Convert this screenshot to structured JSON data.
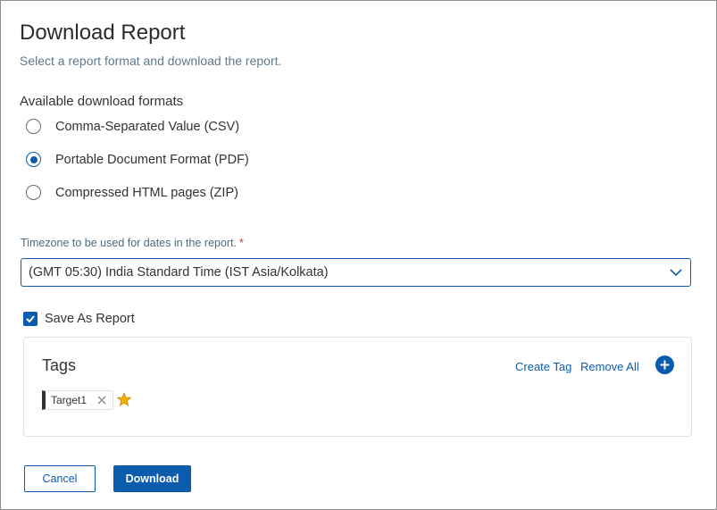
{
  "dialog": {
    "title": "Download Report",
    "subtitle": "Select a report format and download the report."
  },
  "formats": {
    "label": "Available download formats",
    "options": [
      {
        "label": "Comma-Separated Value (CSV)",
        "selected": false
      },
      {
        "label": "Portable Document Format (PDF)",
        "selected": true
      },
      {
        "label": "Compressed HTML pages (ZIP)",
        "selected": false
      }
    ]
  },
  "timezone": {
    "label": "Timezone to be used for dates in the report.",
    "required_marker": "*",
    "value": "(GMT 05:30) India Standard Time (IST Asia/Kolkata)"
  },
  "save_as_report": {
    "label": "Save As Report",
    "checked": true
  },
  "tags": {
    "title": "Tags",
    "create_tag": "Create Tag",
    "remove_all": "Remove All",
    "items": [
      {
        "label": "Target1",
        "favorite": true
      }
    ]
  },
  "buttons": {
    "cancel": "Cancel",
    "download": "Download"
  },
  "colors": {
    "accent": "#0b5cad",
    "required": "#d0342c",
    "star": "#f5b301"
  }
}
